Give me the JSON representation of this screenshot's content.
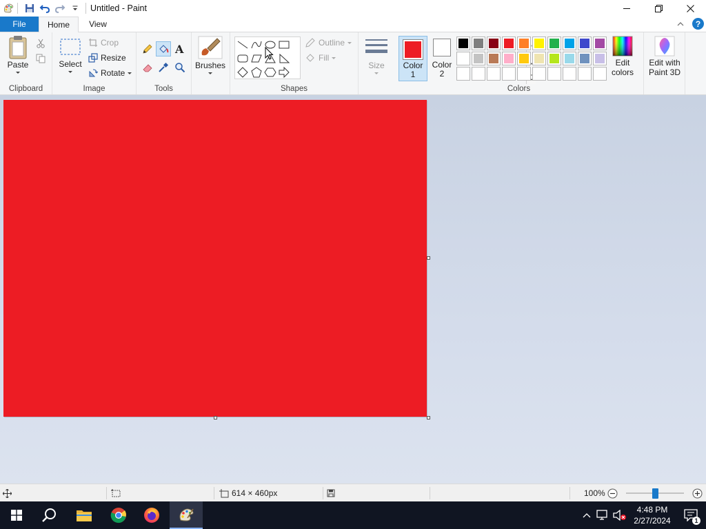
{
  "app": {
    "title": "Untitled - Paint"
  },
  "tabs": {
    "file": "File",
    "home": "Home",
    "view": "View"
  },
  "ribbon": {
    "clipboard": {
      "paste": "Paste",
      "group": "Clipboard"
    },
    "image": {
      "select": "Select",
      "crop": "Crop",
      "resize": "Resize",
      "rotate": "Rotate",
      "group": "Image"
    },
    "tools": {
      "group": "Tools"
    },
    "brushes": {
      "label": "Brushes"
    },
    "shapes": {
      "outline": "Outline",
      "fill": "Fill",
      "group": "Shapes"
    },
    "size": {
      "label": "Size"
    },
    "colors": {
      "color1_label": "Color",
      "color1_num": "1",
      "color2_label": "Color",
      "color2_num": "2",
      "color1_value": "#ed1c24",
      "color2_value": "#ffffff",
      "edit_colors_1": "Edit",
      "edit_colors_2": "colors",
      "edit_3d_1": "Edit with",
      "edit_3d_2": "Paint 3D",
      "group": "Colors",
      "palette_row1": [
        "#000000",
        "#7f7f7f",
        "#880015",
        "#ed1c24",
        "#ff7f27",
        "#fff200",
        "#22b14c",
        "#00a2e8",
        "#3f48cc",
        "#a349a4"
      ],
      "palette_row2": [
        "#ffffff",
        "#c3c3c3",
        "#b97a57",
        "#ffaec9",
        "#ffc90e",
        "#efe4b0",
        "#b5e61d",
        "#99d9ea",
        "#7092be",
        "#c8bfe7"
      ],
      "palette_row3": [
        "#ffffff",
        "#ffffff",
        "#ffffff",
        "#ffffff",
        "#ffffff",
        "#ffffff",
        "#ffffff",
        "#ffffff",
        "#ffffff",
        "#ffffff"
      ]
    }
  },
  "canvas": {
    "fill_color": "#ed1c24"
  },
  "status": {
    "dimensions": "614 × 460px",
    "zoom": "100%"
  },
  "taskbar": {
    "time": "4:48 PM",
    "date": "2/27/2024",
    "notifications": "1"
  }
}
